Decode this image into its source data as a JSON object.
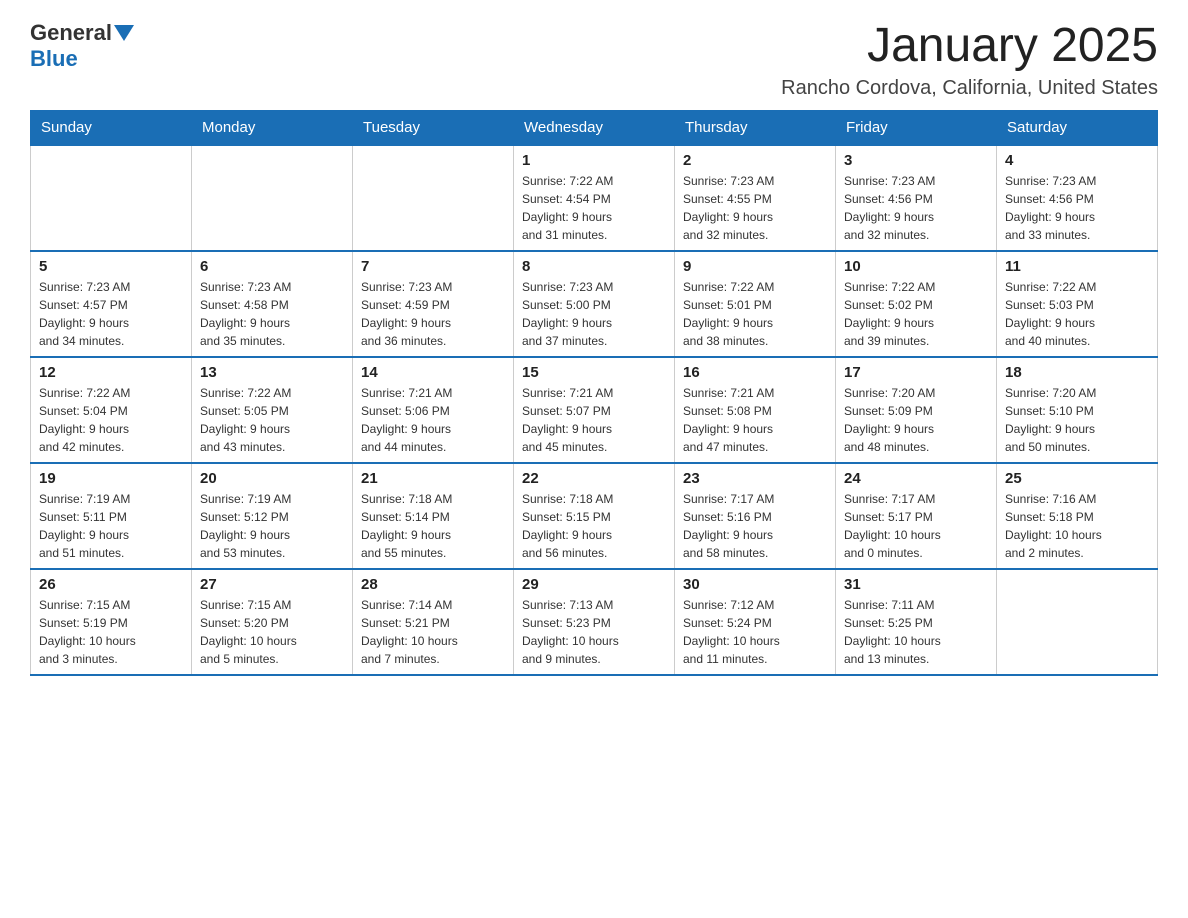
{
  "logo": {
    "general": "General",
    "blue": "Blue"
  },
  "header": {
    "month": "January 2025",
    "location": "Rancho Cordova, California, United States"
  },
  "weekdays": [
    "Sunday",
    "Monday",
    "Tuesday",
    "Wednesday",
    "Thursday",
    "Friday",
    "Saturday"
  ],
  "weeks": [
    [
      {
        "day": "",
        "info": ""
      },
      {
        "day": "",
        "info": ""
      },
      {
        "day": "",
        "info": ""
      },
      {
        "day": "1",
        "info": "Sunrise: 7:22 AM\nSunset: 4:54 PM\nDaylight: 9 hours\nand 31 minutes."
      },
      {
        "day": "2",
        "info": "Sunrise: 7:23 AM\nSunset: 4:55 PM\nDaylight: 9 hours\nand 32 minutes."
      },
      {
        "day": "3",
        "info": "Sunrise: 7:23 AM\nSunset: 4:56 PM\nDaylight: 9 hours\nand 32 minutes."
      },
      {
        "day": "4",
        "info": "Sunrise: 7:23 AM\nSunset: 4:56 PM\nDaylight: 9 hours\nand 33 minutes."
      }
    ],
    [
      {
        "day": "5",
        "info": "Sunrise: 7:23 AM\nSunset: 4:57 PM\nDaylight: 9 hours\nand 34 minutes."
      },
      {
        "day": "6",
        "info": "Sunrise: 7:23 AM\nSunset: 4:58 PM\nDaylight: 9 hours\nand 35 minutes."
      },
      {
        "day": "7",
        "info": "Sunrise: 7:23 AM\nSunset: 4:59 PM\nDaylight: 9 hours\nand 36 minutes."
      },
      {
        "day": "8",
        "info": "Sunrise: 7:23 AM\nSunset: 5:00 PM\nDaylight: 9 hours\nand 37 minutes."
      },
      {
        "day": "9",
        "info": "Sunrise: 7:22 AM\nSunset: 5:01 PM\nDaylight: 9 hours\nand 38 minutes."
      },
      {
        "day": "10",
        "info": "Sunrise: 7:22 AM\nSunset: 5:02 PM\nDaylight: 9 hours\nand 39 minutes."
      },
      {
        "day": "11",
        "info": "Sunrise: 7:22 AM\nSunset: 5:03 PM\nDaylight: 9 hours\nand 40 minutes."
      }
    ],
    [
      {
        "day": "12",
        "info": "Sunrise: 7:22 AM\nSunset: 5:04 PM\nDaylight: 9 hours\nand 42 minutes."
      },
      {
        "day": "13",
        "info": "Sunrise: 7:22 AM\nSunset: 5:05 PM\nDaylight: 9 hours\nand 43 minutes."
      },
      {
        "day": "14",
        "info": "Sunrise: 7:21 AM\nSunset: 5:06 PM\nDaylight: 9 hours\nand 44 minutes."
      },
      {
        "day": "15",
        "info": "Sunrise: 7:21 AM\nSunset: 5:07 PM\nDaylight: 9 hours\nand 45 minutes."
      },
      {
        "day": "16",
        "info": "Sunrise: 7:21 AM\nSunset: 5:08 PM\nDaylight: 9 hours\nand 47 minutes."
      },
      {
        "day": "17",
        "info": "Sunrise: 7:20 AM\nSunset: 5:09 PM\nDaylight: 9 hours\nand 48 minutes."
      },
      {
        "day": "18",
        "info": "Sunrise: 7:20 AM\nSunset: 5:10 PM\nDaylight: 9 hours\nand 50 minutes."
      }
    ],
    [
      {
        "day": "19",
        "info": "Sunrise: 7:19 AM\nSunset: 5:11 PM\nDaylight: 9 hours\nand 51 minutes."
      },
      {
        "day": "20",
        "info": "Sunrise: 7:19 AM\nSunset: 5:12 PM\nDaylight: 9 hours\nand 53 minutes."
      },
      {
        "day": "21",
        "info": "Sunrise: 7:18 AM\nSunset: 5:14 PM\nDaylight: 9 hours\nand 55 minutes."
      },
      {
        "day": "22",
        "info": "Sunrise: 7:18 AM\nSunset: 5:15 PM\nDaylight: 9 hours\nand 56 minutes."
      },
      {
        "day": "23",
        "info": "Sunrise: 7:17 AM\nSunset: 5:16 PM\nDaylight: 9 hours\nand 58 minutes."
      },
      {
        "day": "24",
        "info": "Sunrise: 7:17 AM\nSunset: 5:17 PM\nDaylight: 10 hours\nand 0 minutes."
      },
      {
        "day": "25",
        "info": "Sunrise: 7:16 AM\nSunset: 5:18 PM\nDaylight: 10 hours\nand 2 minutes."
      }
    ],
    [
      {
        "day": "26",
        "info": "Sunrise: 7:15 AM\nSunset: 5:19 PM\nDaylight: 10 hours\nand 3 minutes."
      },
      {
        "day": "27",
        "info": "Sunrise: 7:15 AM\nSunset: 5:20 PM\nDaylight: 10 hours\nand 5 minutes."
      },
      {
        "day": "28",
        "info": "Sunrise: 7:14 AM\nSunset: 5:21 PM\nDaylight: 10 hours\nand 7 minutes."
      },
      {
        "day": "29",
        "info": "Sunrise: 7:13 AM\nSunset: 5:23 PM\nDaylight: 10 hours\nand 9 minutes."
      },
      {
        "day": "30",
        "info": "Sunrise: 7:12 AM\nSunset: 5:24 PM\nDaylight: 10 hours\nand 11 minutes."
      },
      {
        "day": "31",
        "info": "Sunrise: 7:11 AM\nSunset: 5:25 PM\nDaylight: 10 hours\nand 13 minutes."
      },
      {
        "day": "",
        "info": ""
      }
    ]
  ]
}
